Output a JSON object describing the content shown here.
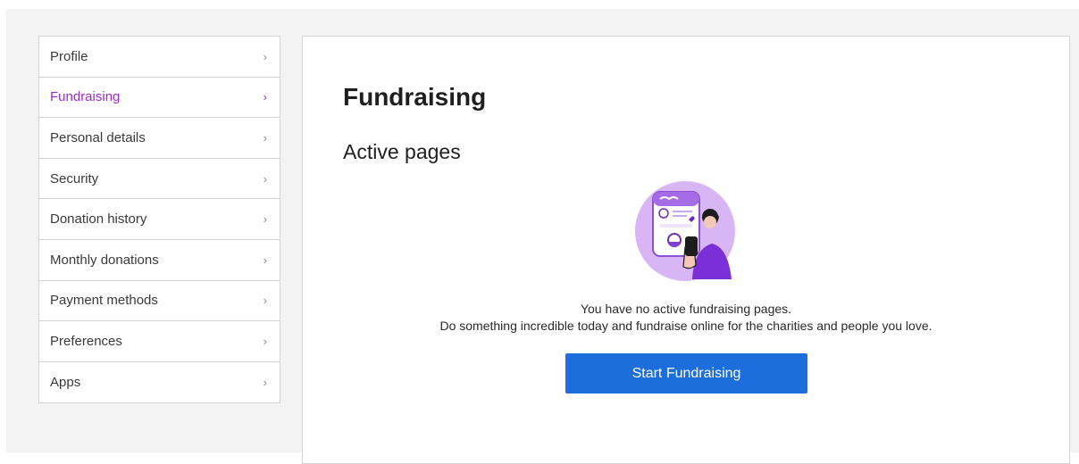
{
  "sidebar": {
    "items": [
      {
        "label": "Profile",
        "active": false
      },
      {
        "label": "Fundraising",
        "active": true
      },
      {
        "label": "Personal details",
        "active": false
      },
      {
        "label": "Security",
        "active": false
      },
      {
        "label": "Donation history",
        "active": false
      },
      {
        "label": "Monthly donations",
        "active": false
      },
      {
        "label": "Payment methods",
        "active": false
      },
      {
        "label": "Preferences",
        "active": false
      },
      {
        "label": "Apps",
        "active": false
      }
    ],
    "chevron": "›"
  },
  "main": {
    "title": "Fundraising",
    "section_title": "Active pages",
    "illustration": "fundraiser-phone-illustration",
    "empty_line1": "You have no active fundraising pages.",
    "empty_line2": "Do something incredible today and fundraise online for the charities and people you love.",
    "cta_label": "Start Fundraising"
  },
  "colors": {
    "accent": "#9b2bd1",
    "button": "#1b6edb",
    "border": "#d4d4d4"
  }
}
